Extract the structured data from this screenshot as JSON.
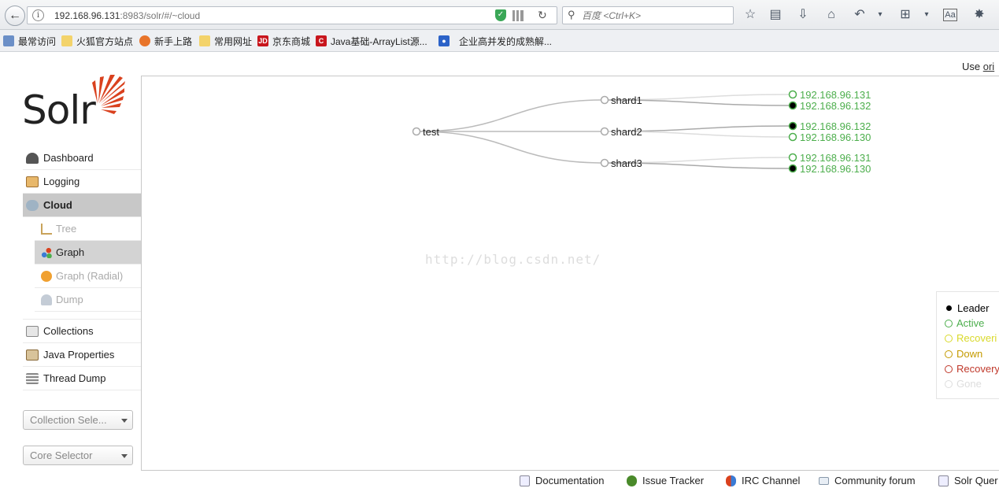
{
  "browser": {
    "url_host": "192.168.96.131",
    "url_rest": ":8983/solr/#/~cloud",
    "search_placeholder": "百度 <Ctrl+K>"
  },
  "bookmarks": [
    "最常访问",
    "火狐官方站点",
    "新手上路",
    "常用网址",
    "京东商城",
    "Java基础-ArrayList源...",
    "企业高并发的成熟解..."
  ],
  "page": {
    "use_prefix": "Use ",
    "use_link": "ori"
  },
  "logo": {
    "text": "Solr"
  },
  "nav": {
    "dashboard": "Dashboard",
    "logging": "Logging",
    "cloud": "Cloud",
    "cloud_sub": [
      "Tree",
      "Graph",
      "Graph (Radial)",
      "Dump"
    ],
    "collections": "Collections",
    "java_properties": "Java Properties",
    "thread_dump": "Thread Dump"
  },
  "selectors": {
    "collection": "Collection Sele...",
    "core": "Core Selector"
  },
  "graph": {
    "collection": "test",
    "shards": [
      {
        "name": "shard1",
        "replicas": [
          {
            "host": "192.168.96.131",
            "state": "active"
          },
          {
            "host": "192.168.96.132",
            "state": "leader"
          }
        ]
      },
      {
        "name": "shard2",
        "replicas": [
          {
            "host": "192.168.96.132",
            "state": "leader"
          },
          {
            "host": "192.168.96.130",
            "state": "active"
          }
        ]
      },
      {
        "name": "shard3",
        "replicas": [
          {
            "host": "192.168.96.131",
            "state": "active"
          },
          {
            "host": "192.168.96.130",
            "state": "leader"
          }
        ]
      }
    ]
  },
  "watermark": "http://blog.csdn.net/",
  "legend": [
    {
      "label": "Leader",
      "color": "#000000"
    },
    {
      "label": "Active",
      "color": "#4cae4c"
    },
    {
      "label": "Recoveri",
      "color": "#d9d92a"
    },
    {
      "label": "Down",
      "color": "#c49a00"
    },
    {
      "label": "Recovery",
      "color": "#c0392b"
    },
    {
      "label": "Gone",
      "color": "#dddddd"
    }
  ],
  "footer": [
    "Documentation",
    "Issue Tracker",
    "IRC Channel",
    "Community forum",
    "Solr Quer"
  ]
}
